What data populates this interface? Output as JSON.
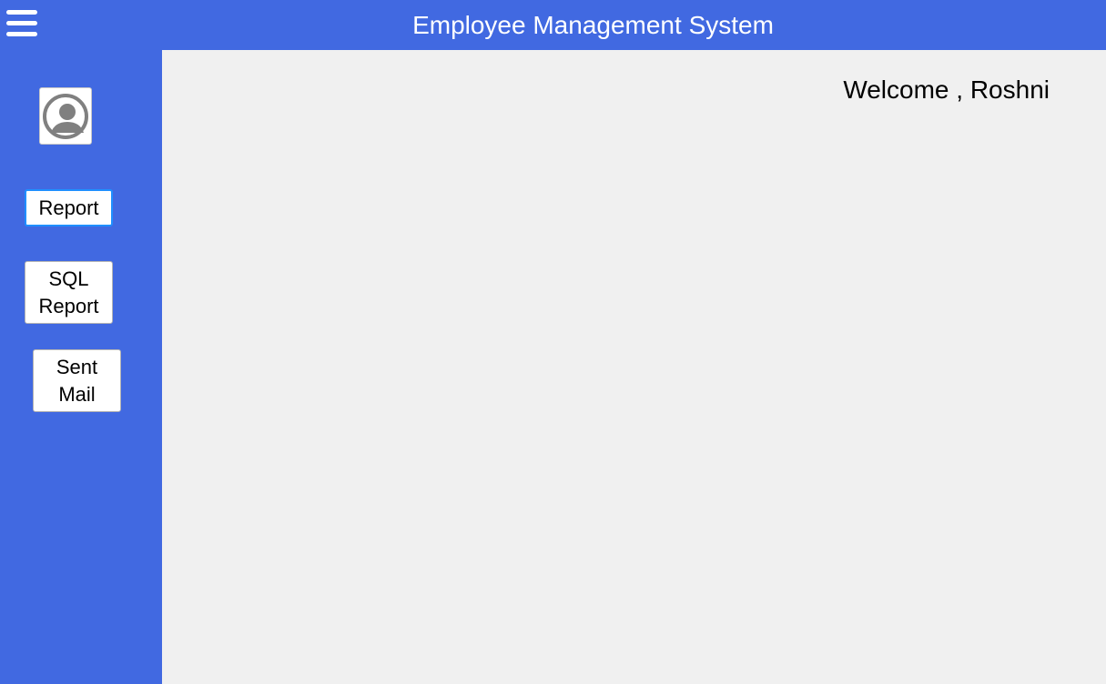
{
  "header": {
    "title": "Employee Management System",
    "menu_icon": "hamburger-menu-icon"
  },
  "sidebar": {
    "avatar_icon": "user-profile-icon",
    "buttons": [
      {
        "label": "Report"
      },
      {
        "label": "SQL\nReport"
      },
      {
        "label": "Sent\nMail"
      }
    ]
  },
  "main": {
    "welcome_text": "Welcome , Roshni"
  },
  "colors": {
    "brand_blue": "#4169e1",
    "content_background": "#f0f0f0",
    "focus_border": "#1f8fff"
  }
}
